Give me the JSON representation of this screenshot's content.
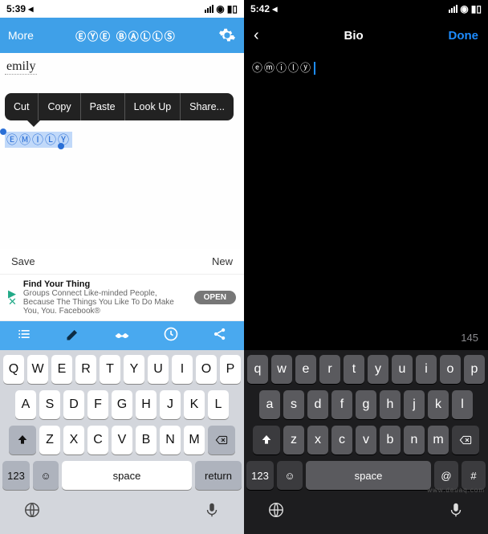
{
  "left": {
    "status": {
      "time": "5:39",
      "loc": "◂"
    },
    "header": {
      "more": "More",
      "title": "ⒺⓎⒺ ⒷⒶⓁⓁⓈ"
    },
    "text_plain": "emily",
    "context_menu": [
      "Cut",
      "Copy",
      "Paste",
      "Look Up",
      "Share..."
    ],
    "selected_text": "ⒺⓂⒾⓁⓎ",
    "actions": {
      "save": "Save",
      "new": "New"
    },
    "ad": {
      "title": "Find Your Thing",
      "body": "Groups Connect Like-minded People, Because The Things You Like To Do Make You, You. Facebook®",
      "cta": "OPEN"
    },
    "keyboard": {
      "rows": [
        [
          "Q",
          "W",
          "E",
          "R",
          "T",
          "Y",
          "U",
          "I",
          "O",
          "P"
        ],
        [
          "A",
          "S",
          "D",
          "F",
          "G",
          "H",
          "J",
          "K",
          "L"
        ],
        [
          "Z",
          "X",
          "C",
          "V",
          "B",
          "N",
          "M"
        ]
      ],
      "nums": "123",
      "space": "space",
      "ret": "return"
    }
  },
  "right": {
    "status": {
      "time": "5:42",
      "loc": "◂"
    },
    "header": {
      "title": "Bio",
      "done": "Done"
    },
    "bio_text": "ⓔⓜⓘⓛⓨ",
    "counter": "145",
    "keyboard": {
      "rows": [
        [
          "q",
          "w",
          "e",
          "r",
          "t",
          "y",
          "u",
          "i",
          "o",
          "p"
        ],
        [
          "a",
          "s",
          "d",
          "f",
          "g",
          "h",
          "j",
          "k",
          "l"
        ],
        [
          "z",
          "x",
          "c",
          "v",
          "b",
          "n",
          "m"
        ]
      ],
      "nums": "123",
      "space": "space",
      "at": "@",
      "hash": "#"
    }
  },
  "watermark": "www.deuaq.com"
}
